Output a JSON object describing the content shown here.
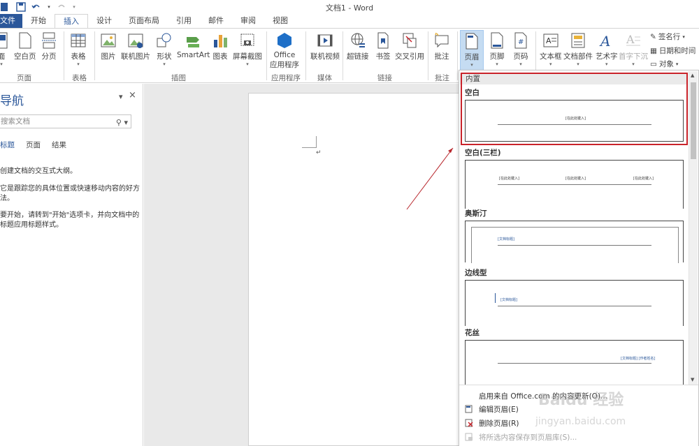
{
  "window": {
    "title": "文档1 - Word"
  },
  "quick_access": [
    "save-icon",
    "undo-icon",
    "redo-icon",
    "customize-icon"
  ],
  "tabs": [
    {
      "label": "文件"
    },
    {
      "label": "开始"
    },
    {
      "label": "插入"
    },
    {
      "label": "设计"
    },
    {
      "label": "页面布局"
    },
    {
      "label": "引用"
    },
    {
      "label": "邮件"
    },
    {
      "label": "审阅"
    },
    {
      "label": "视图"
    }
  ],
  "ribbon": {
    "pages": {
      "label": "页面",
      "items": [
        "面",
        "空白页",
        "分页"
      ]
    },
    "tables": {
      "label": "表格",
      "items": [
        "表格"
      ]
    },
    "illustrations": {
      "label": "插图",
      "items": [
        "图片",
        "联机图片",
        "形状",
        "SmartArt",
        "图表",
        "屏幕截图"
      ]
    },
    "apps": {
      "label": "应用程序",
      "items": [
        "Office",
        "应用程序"
      ]
    },
    "media": {
      "label": "媒体",
      "items": [
        "联机视频"
      ]
    },
    "links": {
      "label": "链接",
      "items": [
        "超链接",
        "书签",
        "交叉引用"
      ]
    },
    "comments": {
      "label": "批注",
      "items": [
        "批注"
      ]
    },
    "header_footer": {
      "items": [
        "页眉",
        "页脚",
        "页码"
      ]
    },
    "text": {
      "items": [
        "文本框",
        "文档部件",
        "艺术字",
        "首字下沉"
      ],
      "small": [
        "签名行",
        "日期和时间",
        "对象"
      ]
    }
  },
  "nav": {
    "title": "导航",
    "search_placeholder": "搜索文档",
    "tabs": [
      "标题",
      "页面",
      "结果"
    ],
    "texts": [
      "创建文档的交互式大纲。",
      "它是跟踪您的具体位置或快速移动内容的好方法。",
      "要开始，请转到\"开始\"选项卡，并向文档中的标题应用标题样式。"
    ]
  },
  "gallery": {
    "section": "内置",
    "items": [
      {
        "title": "空白",
        "placeholders": [
          "[在此处键入]"
        ]
      },
      {
        "title": "空白(三栏)",
        "placeholders": [
          "[在此处键入]",
          "[在此处键入]",
          "[在此处键入]"
        ]
      },
      {
        "title": "奥斯汀",
        "placeholders": [
          "[文档标题]"
        ]
      },
      {
        "title": "边线型",
        "placeholders": [
          "[文档标题]"
        ]
      },
      {
        "title": "花丝",
        "placeholders": [
          "[文档标题] [作者姓名]"
        ]
      }
    ],
    "menu": [
      {
        "label": "启用来自 Office.com 的内容更新(O)...",
        "enabled": true
      },
      {
        "label": "编辑页眉(E)",
        "enabled": true
      },
      {
        "label": "删除页眉(R)",
        "enabled": true
      },
      {
        "label": "将所选内容保存到页眉库(S)...",
        "enabled": false
      }
    ]
  },
  "watermark": {
    "text": "Baidu 经验",
    "sub": "jingyan.baidu.com"
  },
  "colors": {
    "accent": "#2b579a",
    "highlight": "#c9232a"
  }
}
